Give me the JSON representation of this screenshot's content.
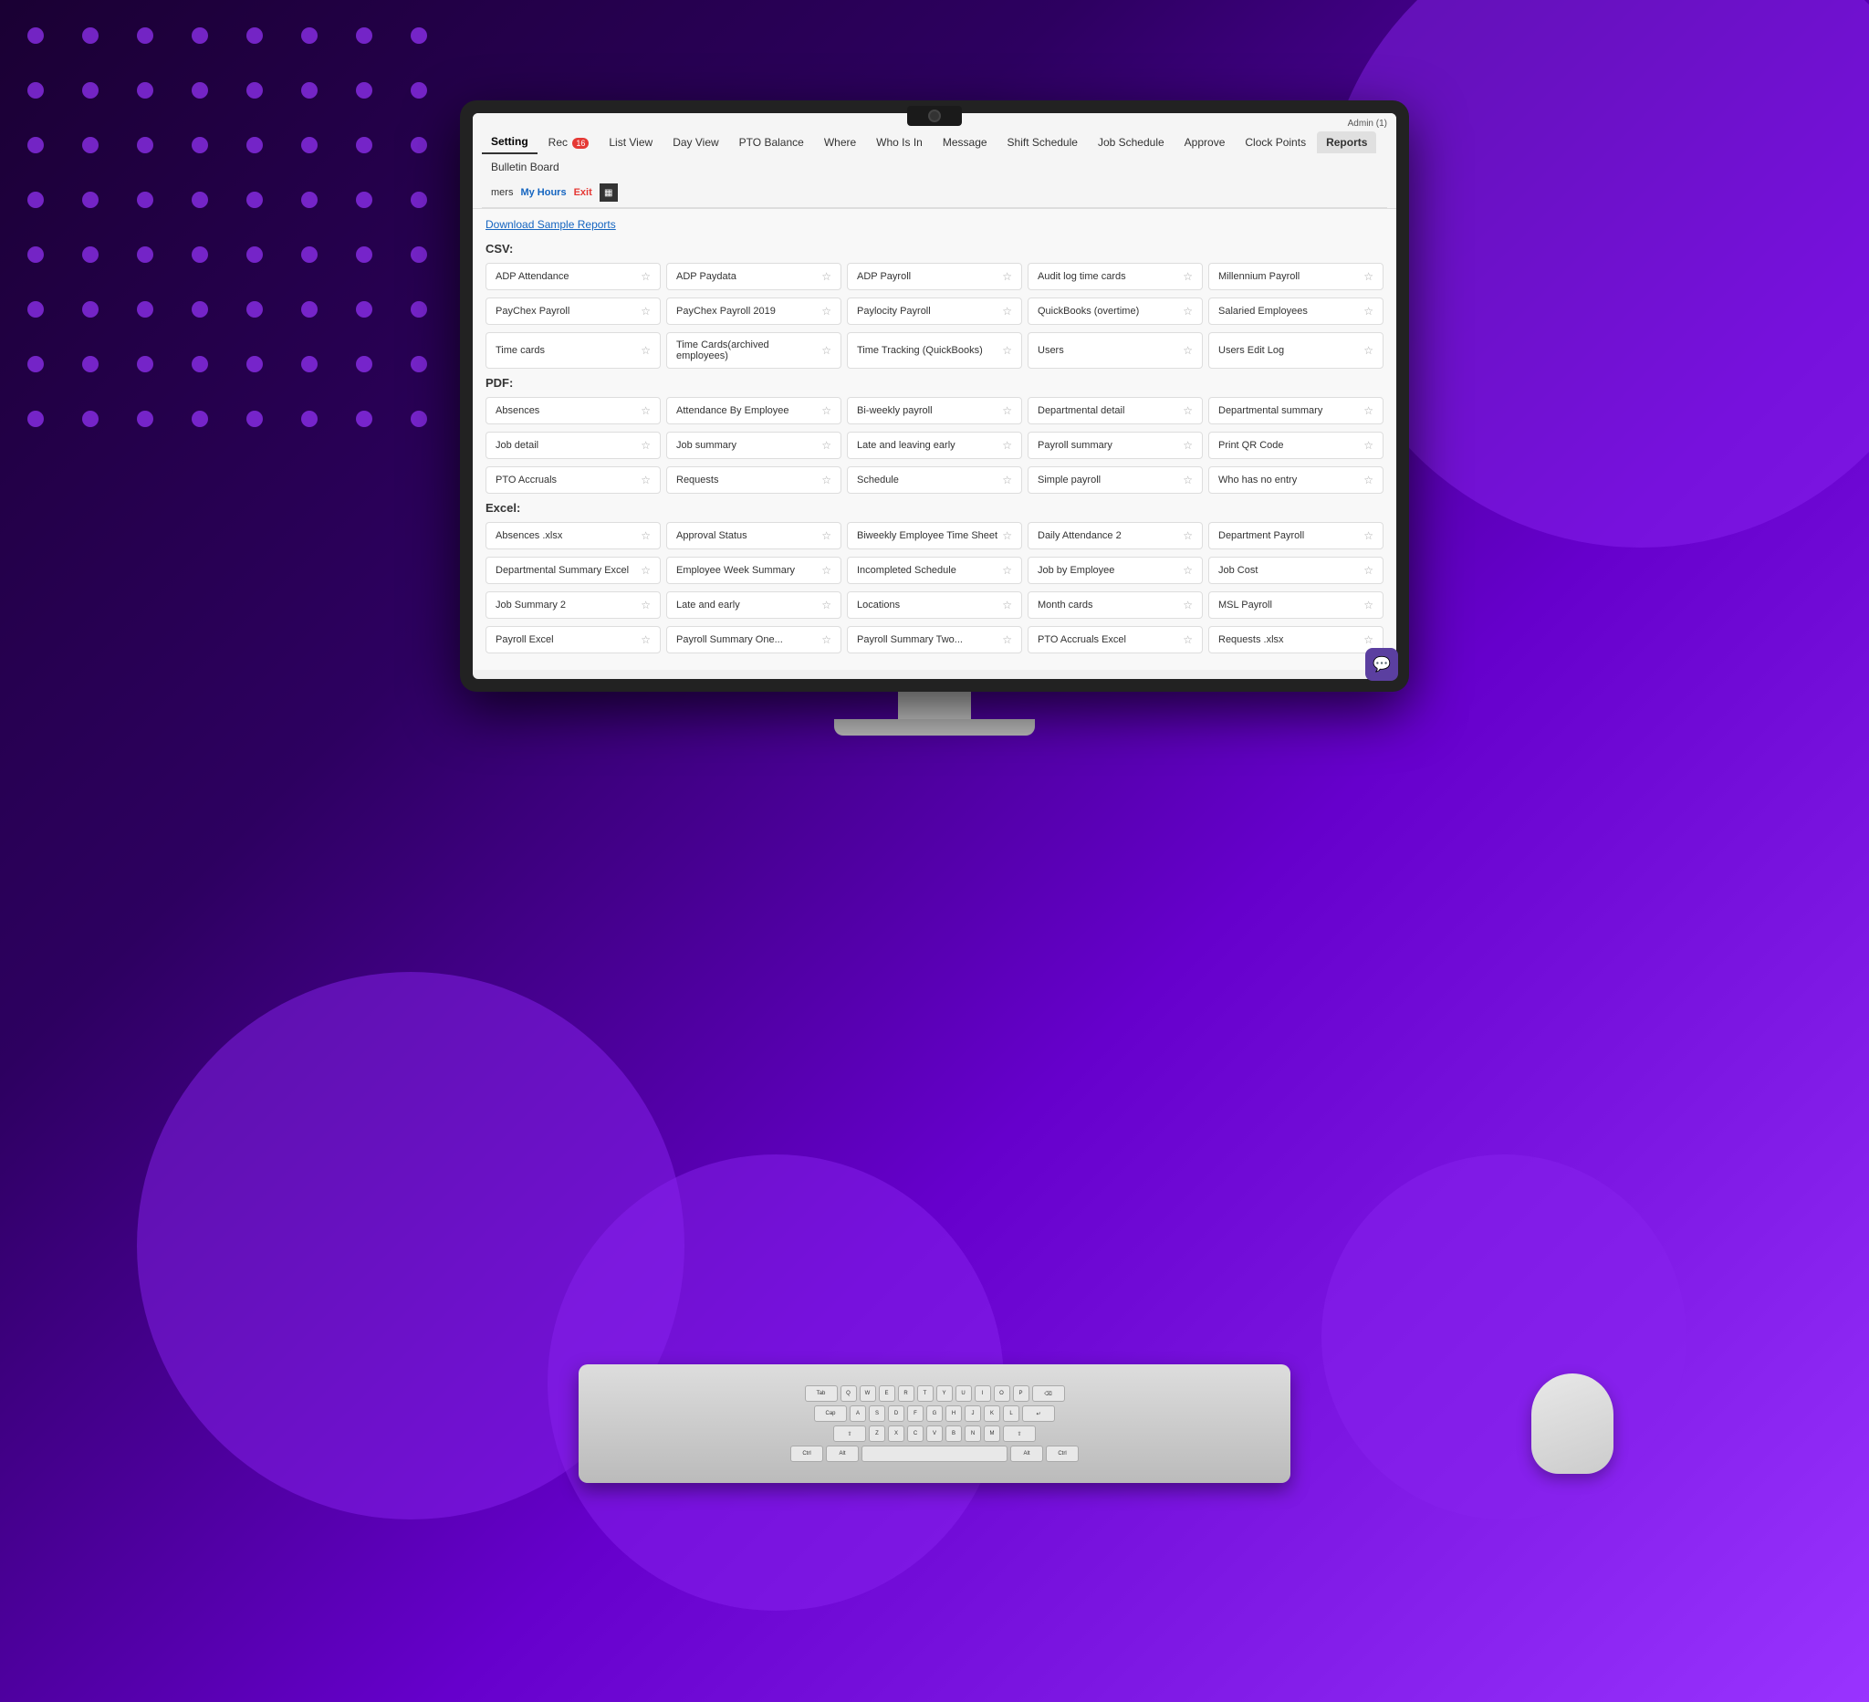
{
  "admin_label": "Admin (1)",
  "nav": {
    "tabs": [
      {
        "id": "setting",
        "label": "Setting",
        "active": true
      },
      {
        "id": "rec",
        "label": "Rec",
        "badge": "16"
      },
      {
        "id": "list-view",
        "label": "List View"
      },
      {
        "id": "day-view",
        "label": "Day View"
      },
      {
        "id": "pto-balance",
        "label": "PTO Balance"
      },
      {
        "id": "where",
        "label": "Where"
      },
      {
        "id": "who-is-in",
        "label": "Who Is In"
      },
      {
        "id": "message",
        "label": "Message"
      },
      {
        "id": "shift-schedule",
        "label": "Shift Schedule"
      },
      {
        "id": "job-schedule",
        "label": "Job Schedule"
      },
      {
        "id": "approve",
        "label": "Approve"
      },
      {
        "id": "clock-points",
        "label": "Clock Points"
      },
      {
        "id": "reports",
        "label": "Reports",
        "active_reports": true
      },
      {
        "id": "bulletin-board",
        "label": "Bulletin Board"
      }
    ],
    "sub_tabs": [
      {
        "id": "timers",
        "label": "mers"
      },
      {
        "id": "my-hours",
        "label": "My Hours"
      },
      {
        "id": "exit",
        "label": "Exit",
        "exit": true
      }
    ]
  },
  "download_link": "Download Sample Reports",
  "sections": {
    "csv": {
      "label": "CSV:",
      "rows": [
        [
          {
            "label": "ADP Attendance"
          },
          {
            "label": "ADP Paydata"
          },
          {
            "label": "ADP Payroll"
          },
          {
            "label": "Audit log time cards"
          },
          {
            "label": "Millennium Payroll"
          }
        ],
        [
          {
            "label": "PayChex Payroll"
          },
          {
            "label": "PayChex Payroll 2019"
          },
          {
            "label": "Paylocity Payroll"
          },
          {
            "label": "QuickBooks (overtime)"
          },
          {
            "label": "Salaried Employees"
          }
        ],
        [
          {
            "label": "Time cards"
          },
          {
            "label": "Time Cards(archived employees)"
          },
          {
            "label": "Time Tracking (QuickBooks)"
          },
          {
            "label": "Users"
          },
          {
            "label": "Users Edit Log"
          }
        ]
      ]
    },
    "pdf": {
      "label": "PDF:",
      "rows": [
        [
          {
            "label": "Absences"
          },
          {
            "label": "Attendance By Employee"
          },
          {
            "label": "Bi-weekly payroll"
          },
          {
            "label": "Departmental detail"
          },
          {
            "label": "Departmental summary"
          }
        ],
        [
          {
            "label": "Job detail"
          },
          {
            "label": "Job summary"
          },
          {
            "label": "Late and leaving early"
          },
          {
            "label": "Payroll summary"
          },
          {
            "label": "Print QR Code"
          }
        ],
        [
          {
            "label": "PTO Accruals"
          },
          {
            "label": "Requests"
          },
          {
            "label": "Schedule"
          },
          {
            "label": "Simple payroll"
          },
          {
            "label": "Who has no entry"
          }
        ]
      ]
    },
    "excel": {
      "label": "Excel:",
      "rows": [
        [
          {
            "label": "Absences .xlsx"
          },
          {
            "label": "Approval Status"
          },
          {
            "label": "Biweekly Employee Time Sheet"
          },
          {
            "label": "Daily Attendance 2"
          },
          {
            "label": "Department Payroll"
          }
        ],
        [
          {
            "label": "Departmental Summary Excel"
          },
          {
            "label": "Employee Week Summary"
          },
          {
            "label": "Incompleted Schedule"
          },
          {
            "label": "Job by Employee"
          },
          {
            "label": "Job Cost"
          }
        ],
        [
          {
            "label": "Job Summary 2"
          },
          {
            "label": "Late and early"
          },
          {
            "label": "Locations"
          },
          {
            "label": "Month cards"
          },
          {
            "label": "MSL Payroll"
          }
        ],
        [
          {
            "label": "Payroll Excel"
          },
          {
            "label": "Payroll Summary One..."
          },
          {
            "label": "Payroll Summary Two..."
          },
          {
            "label": "PTO Accruals Excel"
          },
          {
            "label": "Requests .xlsx"
          }
        ]
      ]
    }
  }
}
